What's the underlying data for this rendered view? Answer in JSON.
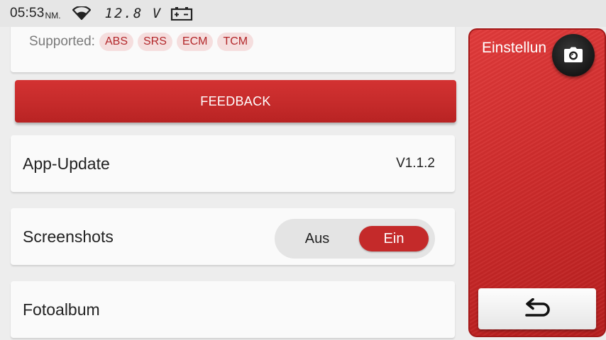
{
  "status_bar": {
    "time": "05:53",
    "ampm": "NM.",
    "voltage": "12.8 V",
    "icons": [
      "wifi-icon",
      "battery-icon"
    ]
  },
  "supported": {
    "label": "Supported:",
    "tags": [
      "ABS",
      "SRS",
      "ECM",
      "TCM"
    ]
  },
  "feedback": {
    "label": "FEEDBACK"
  },
  "settings": {
    "app_update": {
      "label": "App-Update",
      "value": "V1.1.2"
    },
    "screenshots": {
      "label": "Screenshots",
      "off_label": "Aus",
      "on_label": "Ein",
      "selected": "Ein"
    },
    "photo_album": {
      "label": "Fotoalbum"
    }
  },
  "side_panel": {
    "title": "Einstellun",
    "camera_icon": "camera-icon",
    "back_icon": "back-arrow-icon"
  },
  "colors": {
    "accent": "#c42a2a",
    "tag_bg": "#f5dede",
    "tag_text": "#b3272a"
  }
}
